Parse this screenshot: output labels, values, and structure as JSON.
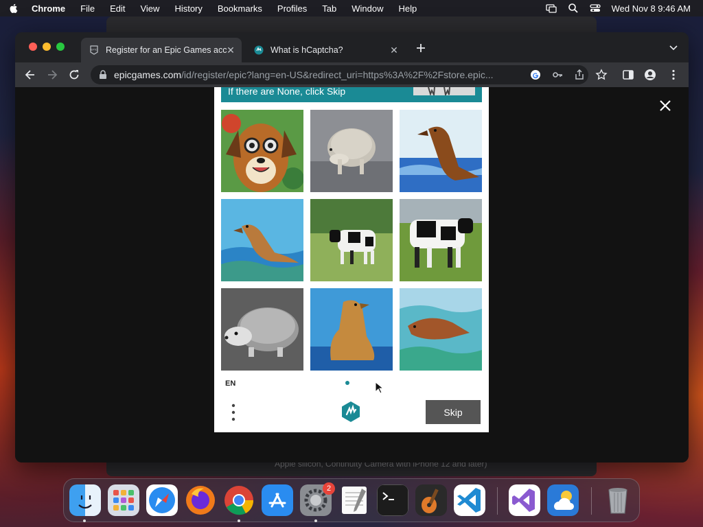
{
  "menubar": {
    "app_name": "Chrome",
    "items": [
      "File",
      "Edit",
      "View",
      "History",
      "Bookmarks",
      "Profiles",
      "Tab",
      "Window",
      "Help"
    ],
    "clock": "Wed Nov 8  9:46 AM"
  },
  "background_window": {
    "text": "Apple silicon, Continuity Camera with iPhone 12 and later)"
  },
  "browser": {
    "tabs": [
      {
        "title": "Register for an Epic Games acc",
        "favicon": "epic-games-icon",
        "active": true
      },
      {
        "title": "What is hCaptcha?",
        "favicon": "hcaptcha-icon",
        "active": false
      }
    ],
    "url_domain": "epicgames.com",
    "url_path": "/id/register/epic?lang=en-US&redirect_uri=https%3A%2F%2Fstore.epic..."
  },
  "captcha": {
    "prompt": "If there are None, click Skip",
    "images": [
      {
        "subject": "dog-with-glasses-painting"
      },
      {
        "subject": "hedgehog-gray"
      },
      {
        "subject": "sea-lion-painting"
      },
      {
        "subject": "sea-lion-painting-swimming"
      },
      {
        "subject": "cow-in-field"
      },
      {
        "subject": "cow-in-field"
      },
      {
        "subject": "hedgehog-gray"
      },
      {
        "subject": "sea-lion-painting"
      },
      {
        "subject": "sea-lion-painting-lying"
      }
    ],
    "language": "EN",
    "page_dots": 2,
    "active_page": 1,
    "skip_label": "Skip",
    "accent_color": "#1a8a95"
  },
  "dock": {
    "apps": [
      "finder-icon",
      "launchpad-icon",
      "safari-icon",
      "firefox-icon",
      "chrome-icon",
      "app-store-icon",
      "system-settings-icon",
      "textedit-icon",
      "terminal-icon",
      "garageband-icon",
      "vscode-icon",
      "visual-studio-icon",
      "weather-icon",
      "trash-icon"
    ],
    "settings_badge": "2"
  }
}
